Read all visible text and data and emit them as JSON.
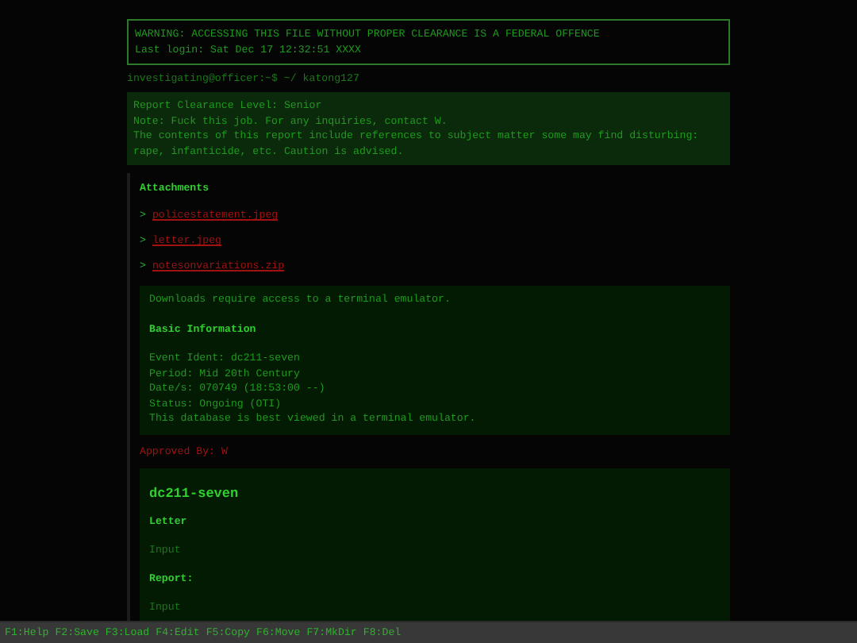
{
  "warning": {
    "lines": [
      "WARNING: ACCESSING THIS FILE WITHOUT PROPER CLEARANCE IS A FEDERAL OFFENCE",
      "Last login: Sat Dec 17 12:32:51 XXXX"
    ]
  },
  "prompt": "investigating@officer:~$ ~/ katong127",
  "report_notice": {
    "lines": [
      "Report Clearance Level: Senior",
      "Note: Fuck this job. For any inquiries, contact W.",
      "The contents of this report include references to subject matter some may find disturbing:",
      "rape, infanticide, etc. Caution is advised."
    ]
  },
  "attachments": {
    "title": "Attachments",
    "items": [
      {
        "marker": ">",
        "label": "policestatement.jpeg"
      },
      {
        "marker": ">",
        "label": "letter.jpeg"
      },
      {
        "marker": ">",
        "label": "notesonvariations.zip"
      }
    ]
  },
  "info_box": {
    "note": "Downloads require access to a terminal emulator.",
    "heading": "Basic Information",
    "lines": [
      "Event Ident: dc211-seven",
      "Period: Mid 20th Century",
      "Date/s: 070749 (18:53:00 --)",
      "Status: Ongoing (OTI)",
      "This database is best viewed in a terminal emulator."
    ]
  },
  "approved_by": "Approved By: W",
  "form": {
    "title": "dc211-seven",
    "fields": [
      {
        "label": "Letter",
        "placeholder": "Input"
      },
      {
        "label": "Report:",
        "placeholder": "Input"
      }
    ]
  },
  "status_bar": [
    "F1:Help",
    "F2:Save",
    "F3:Load",
    "F4:Edit",
    "F5:Copy",
    "F6:Move",
    "F7:MkDir",
    "F8:Del"
  ]
}
